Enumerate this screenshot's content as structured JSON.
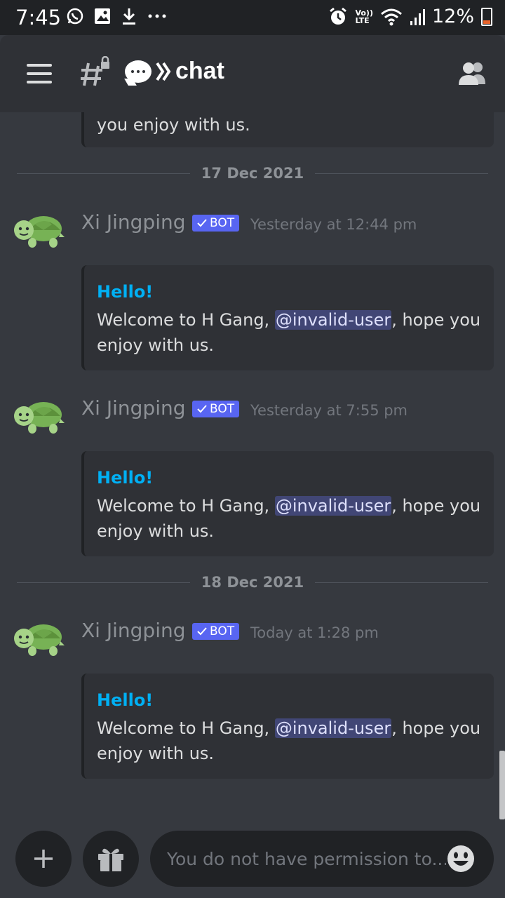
{
  "status_bar": {
    "time": "7:45",
    "battery_percent": "12%",
    "network_label_1": "Vo))",
    "network_label_2": "LTE"
  },
  "header": {
    "channel_title": "chat"
  },
  "top_embed": {
    "text": "you enjoy with us."
  },
  "messages": [
    {
      "date_divider": "17 Dec 2021",
      "author": "Xi Jingping",
      "bot_tag": "BOT",
      "timestamp": "Yesterday at 12:44 pm",
      "embed_title": "Hello!",
      "text_before": "Welcome to H Gang, ",
      "mention": "@invalid-user",
      "text_after": ", hope you enjoy with us."
    },
    {
      "date_divider": "",
      "author": "Xi Jingping",
      "bot_tag": "BOT",
      "timestamp": "Yesterday at 7:55 pm",
      "embed_title": "Hello!",
      "text_before": "Welcome to H Gang, ",
      "mention": "@invalid-user",
      "text_after": ", hope you enjoy with us."
    },
    {
      "date_divider": "18 Dec 2021",
      "author": "Xi Jingping",
      "bot_tag": "BOT",
      "timestamp": "Today at 1:28 pm",
      "embed_title": "Hello!",
      "text_before": "Welcome to H Gang, ",
      "mention": "@invalid-user",
      "text_after": ", hope you enjoy with us."
    }
  ],
  "composer": {
    "placeholder": "You do not have permission to..."
  },
  "icons": {
    "menu": "hamburger-menu-icon",
    "channel": "hash-lock-icon",
    "members": "members-icon",
    "add": "plus-icon",
    "gift": "gift-icon",
    "emoji": "emoji-icon",
    "avatar": "turtle-avatar"
  },
  "colors": {
    "background": "#36393f",
    "header": "#2f3136",
    "bot_tag": "#5865f2",
    "embed_title": "#00b0f4",
    "mention_bg": "#414675"
  }
}
